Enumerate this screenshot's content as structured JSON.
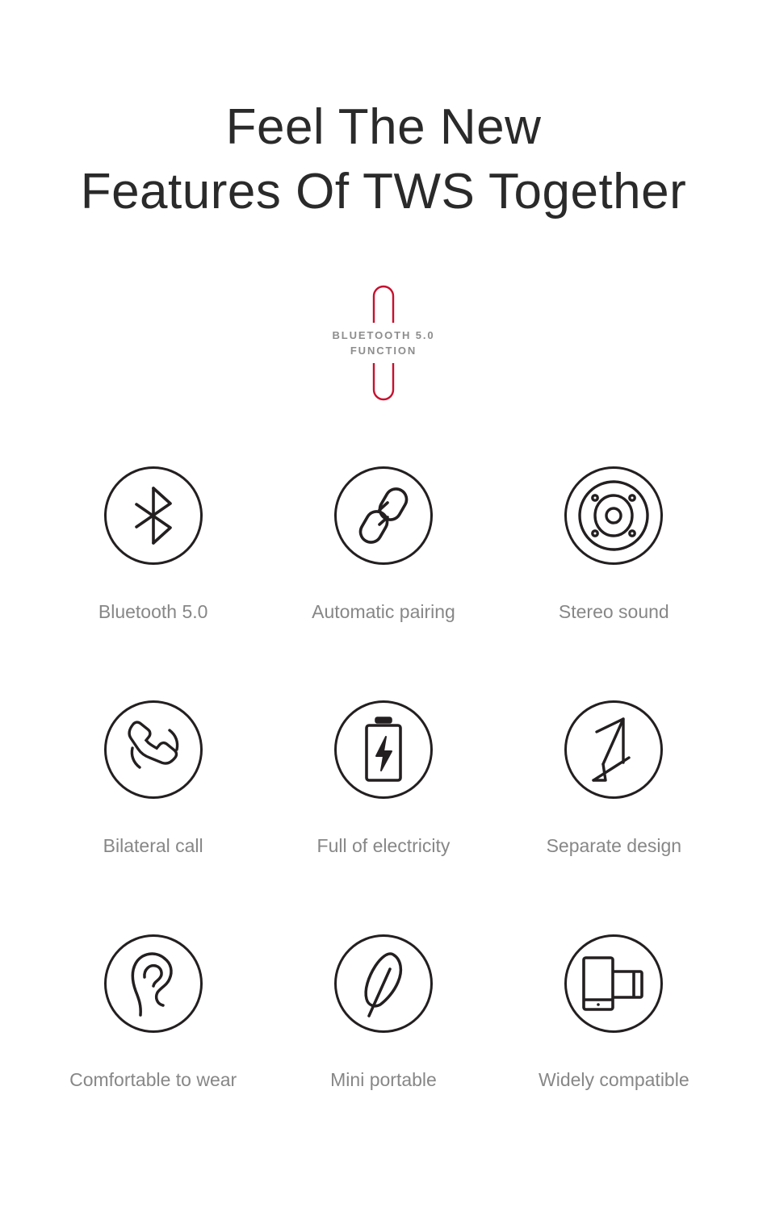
{
  "headline": {
    "line1": "Feel The New",
    "line2": "Features Of TWS Together"
  },
  "badge": {
    "line1": "BLUETOOTH 5.0",
    "line2": "FUNCTION",
    "accent_color": "#c8102e",
    "text_color": "#8d8d8d"
  },
  "colors": {
    "background": "#ffffff",
    "headline": "#2a2a2a",
    "icon_stroke": "#231f20",
    "label": "#878787",
    "accent_red": "#c8102e"
  },
  "features": [
    {
      "icon": "bluetooth-icon",
      "label": "Bluetooth 5.0"
    },
    {
      "icon": "chain-link-icon",
      "label": "Automatic pairing"
    },
    {
      "icon": "speaker-driver-icon",
      "label": "Stereo sound"
    },
    {
      "icon": "phone-handset-waves-icon",
      "label": "Bilateral call"
    },
    {
      "icon": "battery-bolt-icon",
      "label": "Full of electricity"
    },
    {
      "icon": "separate-zigzag-icon",
      "label": "Separate design"
    },
    {
      "icon": "ear-icon",
      "label": "Comfortable to wear"
    },
    {
      "icon": "feather-icon",
      "label": "Mini portable"
    },
    {
      "icon": "phone-tablet-icon",
      "label": "Widely compatible"
    }
  ]
}
